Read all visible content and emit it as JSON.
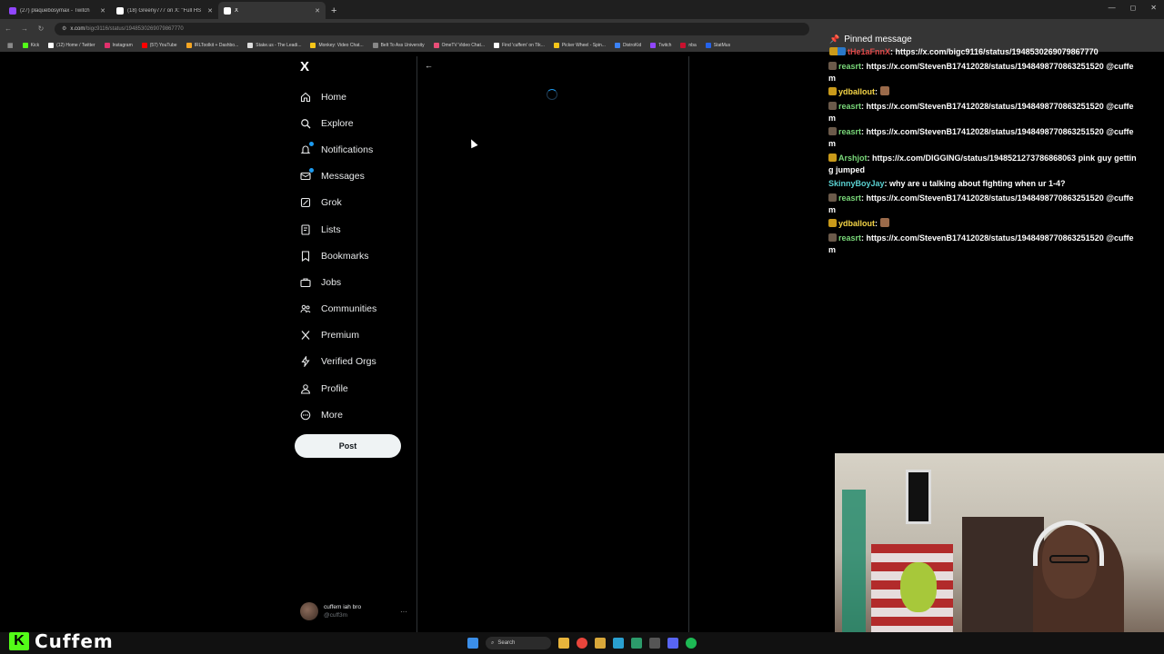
{
  "browser": {
    "tabs": [
      {
        "title": "(27) plaquebosymax - Twitch",
        "icon_color": "#9146ff",
        "active": false
      },
      {
        "title": "(18) Greeny777 on X: \"Full HS",
        "icon_color": "#ffffff",
        "active": false
      },
      {
        "title": "X",
        "icon_color": "#ffffff",
        "active": true
      }
    ],
    "new_tab": "+",
    "url_host": "x.com",
    "url_path": "/bigc9116/status/1948530269079867770",
    "bookmarks": [
      {
        "label": "Kick",
        "color": "#53fc18"
      },
      {
        "label": "(12) Home / Twitter",
        "color": "#ffffff"
      },
      {
        "label": "Instagram",
        "color": "#e1306c"
      },
      {
        "label": "(57) YouTube",
        "color": "#ff0000"
      },
      {
        "label": "IRLToolkit + Dashbo...",
        "color": "#f5a623"
      },
      {
        "label": "Stake.us - The Leadi...",
        "color": "#dddddd"
      },
      {
        "label": "Monkey: Video Chat...",
        "color": "#f5c518"
      },
      {
        "label": "Belt To Ass University",
        "color": "#888888"
      },
      {
        "label": "OmeTV Video Chat...",
        "color": "#e94e77"
      },
      {
        "label": "Find 'cuffem' on Tik...",
        "color": "#ffffff"
      },
      {
        "label": "Picker Wheel - Spin...",
        "color": "#f5c518"
      },
      {
        "label": "DistroKid",
        "color": "#3b82f6"
      },
      {
        "label": "Twitch",
        "color": "#9146ff"
      },
      {
        "label": "nba",
        "color": "#c8102e"
      },
      {
        "label": "StatMus",
        "color": "#2563eb"
      }
    ]
  },
  "x": {
    "logo": "X",
    "nav": [
      {
        "key": "home",
        "label": "Home"
      },
      {
        "key": "explore",
        "label": "Explore"
      },
      {
        "key": "notifications",
        "label": "Notifications"
      },
      {
        "key": "messages",
        "label": "Messages"
      },
      {
        "key": "grok",
        "label": "Grok"
      },
      {
        "key": "lists",
        "label": "Lists"
      },
      {
        "key": "bookmarks",
        "label": "Bookmarks"
      },
      {
        "key": "jobs",
        "label": "Jobs"
      },
      {
        "key": "communities",
        "label": "Communities"
      },
      {
        "key": "premium",
        "label": "Premium"
      },
      {
        "key": "verified-orgs",
        "label": "Verified Orgs"
      },
      {
        "key": "profile",
        "label": "Profile"
      },
      {
        "key": "more",
        "label": "More"
      }
    ],
    "post_label": "Post",
    "profile": {
      "name": "cuffem iah bro",
      "handle": "@cuff3m",
      "more": "···"
    },
    "back": "←"
  },
  "chat": {
    "pinned_title": "Pinned message",
    "pinned": {
      "user": "tHe1aFnnX",
      "text": ": https://x.com/bigc9116/status/1948530269079867770"
    },
    "messages": [
      {
        "user": "reasrt",
        "color": "#7ad97a",
        "badge": "sub",
        "text": "https://x.com/StevenB17412028/status/1948498770863251520 @cuffem"
      },
      {
        "user": "ydballout",
        "color": "#f5d547",
        "badge": "crown",
        "text": "",
        "emote": true
      },
      {
        "user": "reasrt",
        "color": "#7ad97a",
        "badge": "sub",
        "text": "https://x.com/StevenB17412028/status/1948498770863251520 @cuffem"
      },
      {
        "user": "reasrt",
        "color": "#7ad97a",
        "badge": "sub",
        "text": "https://x.com/StevenB17412028/status/1948498770863251520 @cuffem"
      },
      {
        "user": "Arshjot",
        "color": "#7ad97a",
        "badge": "crown",
        "text": "https://x.com/DIGGING/status/1948521273786868063 pink guy getting jumped"
      },
      {
        "user": "SkinnyBoyJay",
        "color": "#5ad1d1",
        "badge": "",
        "text": "why are u talking about fighting when ur 1-4?"
      },
      {
        "user": "reasrt",
        "color": "#7ad97a",
        "badge": "sub",
        "text": "https://x.com/StevenB17412028/status/1948498770863251520 @cuffem"
      },
      {
        "user": "ydballout",
        "color": "#f5d547",
        "badge": "crown",
        "text": "",
        "emote": true
      },
      {
        "user": "reasrt",
        "color": "#7ad97a",
        "badge": "sub",
        "text": "https://x.com/StevenB17412028/status/1948498770863251520 @cuffem"
      }
    ]
  },
  "stream": {
    "brand_letter": "K",
    "brand_name": "Cuffem"
  },
  "taskbar": {
    "search_label": "Search"
  }
}
